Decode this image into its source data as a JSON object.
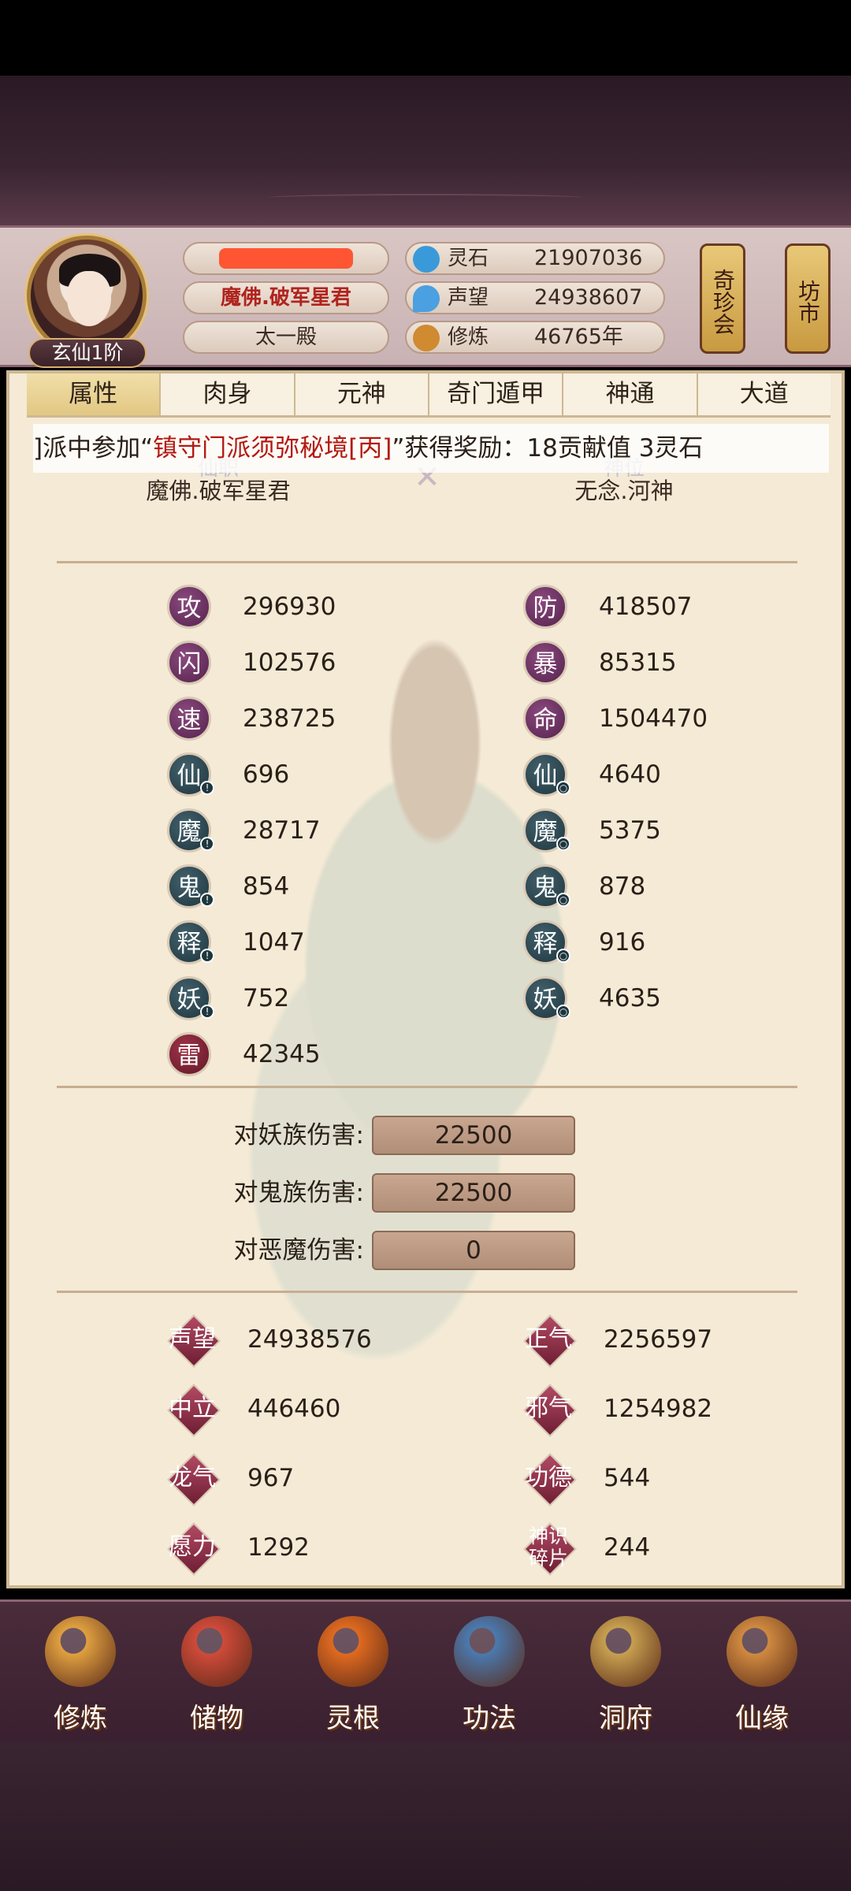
{
  "header": {
    "rank": "玄仙1阶",
    "title": "魔佛.破军星君",
    "hall": "太一殿",
    "resources": [
      {
        "label": "灵石",
        "value": "21907036",
        "icon": "spirit-stone-icon",
        "color": "#3a9ad9"
      },
      {
        "label": "声望",
        "value": "24938607",
        "icon": "prestige-icon",
        "color": "#4aa0e0"
      },
      {
        "label": "修炼",
        "value": "46765年",
        "icon": "meditation-icon",
        "color": "#d08a30"
      }
    ],
    "shop_treasure": "奇珍会",
    "shop_market": "坊市"
  },
  "tabs": [
    "属性",
    "肉身",
    "元神",
    "奇门遁甲",
    "神通",
    "大道"
  ],
  "marquee": {
    "before": "]派中参加“",
    "highlight": "镇守门派须弥秘境[丙]",
    "after": "”获得奖励：18贡献值 3灵石"
  },
  "posts": {
    "left_title": "仙职",
    "left_value": "魔佛.破军星君",
    "right_title": "神位",
    "right_value": "无念.河神"
  },
  "stats_left": [
    {
      "label": "攻",
      "value": "296930",
      "style": "purple",
      "mini": false
    },
    {
      "label": "闪",
      "value": "102576",
      "style": "purple",
      "mini": false
    },
    {
      "label": "速",
      "value": "238725",
      "style": "purple",
      "mini": false
    },
    {
      "label": "仙",
      "value": "696",
      "style": "dteal",
      "mini": true
    },
    {
      "label": "魔",
      "value": "28717",
      "style": "dteal",
      "mini": true
    },
    {
      "label": "鬼",
      "value": "854",
      "style": "dteal",
      "mini": true
    },
    {
      "label": "释",
      "value": "1047",
      "style": "dteal",
      "mini": true
    },
    {
      "label": "妖",
      "value": "752",
      "style": "dteal",
      "mini": true
    },
    {
      "label": "雷",
      "value": "42345",
      "style": "red",
      "mini": false
    }
  ],
  "stats_right": [
    {
      "label": "防",
      "value": "418507",
      "style": "purple",
      "mini": false
    },
    {
      "label": "暴",
      "value": "85315",
      "style": "purple",
      "mini": false
    },
    {
      "label": "命",
      "value": "1504470",
      "style": "purple",
      "mini": false
    },
    {
      "label": "仙",
      "value": "4640",
      "style": "dteal",
      "mini": true
    },
    {
      "label": "魔",
      "value": "5375",
      "style": "dteal",
      "mini": true
    },
    {
      "label": "鬼",
      "value": "878",
      "style": "dteal",
      "mini": true
    },
    {
      "label": "释",
      "value": "916",
      "style": "dteal",
      "mini": true
    },
    {
      "label": "妖",
      "value": "4635",
      "style": "dteal",
      "mini": true
    }
  ],
  "damage": [
    {
      "label": "对妖族伤害:",
      "value": "22500"
    },
    {
      "label": "对鬼族伤害:",
      "value": "22500"
    },
    {
      "label": "对恶魔伤害:",
      "value": "0"
    }
  ],
  "reputation_left": [
    {
      "label": "声望",
      "value": "24938576"
    },
    {
      "label": "中立",
      "value": "446460"
    },
    {
      "label": "龙气",
      "value": "967"
    },
    {
      "label": "愿力",
      "value": "1292"
    }
  ],
  "reputation_right": [
    {
      "label": "正气",
      "value": "2256597"
    },
    {
      "label": "邪气",
      "value": "1254982"
    },
    {
      "label": "功德",
      "value": "544"
    },
    {
      "label": "神识碎片",
      "value": "244"
    }
  ],
  "nav": [
    {
      "label": "修炼",
      "icon": "cultivate-icon",
      "color": "#e0a040"
    },
    {
      "label": "储物",
      "icon": "storage-bag-icon",
      "color": "#d04a3a"
    },
    {
      "label": "灵根",
      "icon": "spirit-root-icon",
      "color": "#e06a20"
    },
    {
      "label": "功法",
      "icon": "scripture-book-icon",
      "color": "#4a7ab0"
    },
    {
      "label": "洞府",
      "icon": "cave-mansion-icon",
      "color": "#c8a050"
    },
    {
      "label": "仙缘",
      "icon": "gourd-icon",
      "color": "#d08a40"
    }
  ]
}
